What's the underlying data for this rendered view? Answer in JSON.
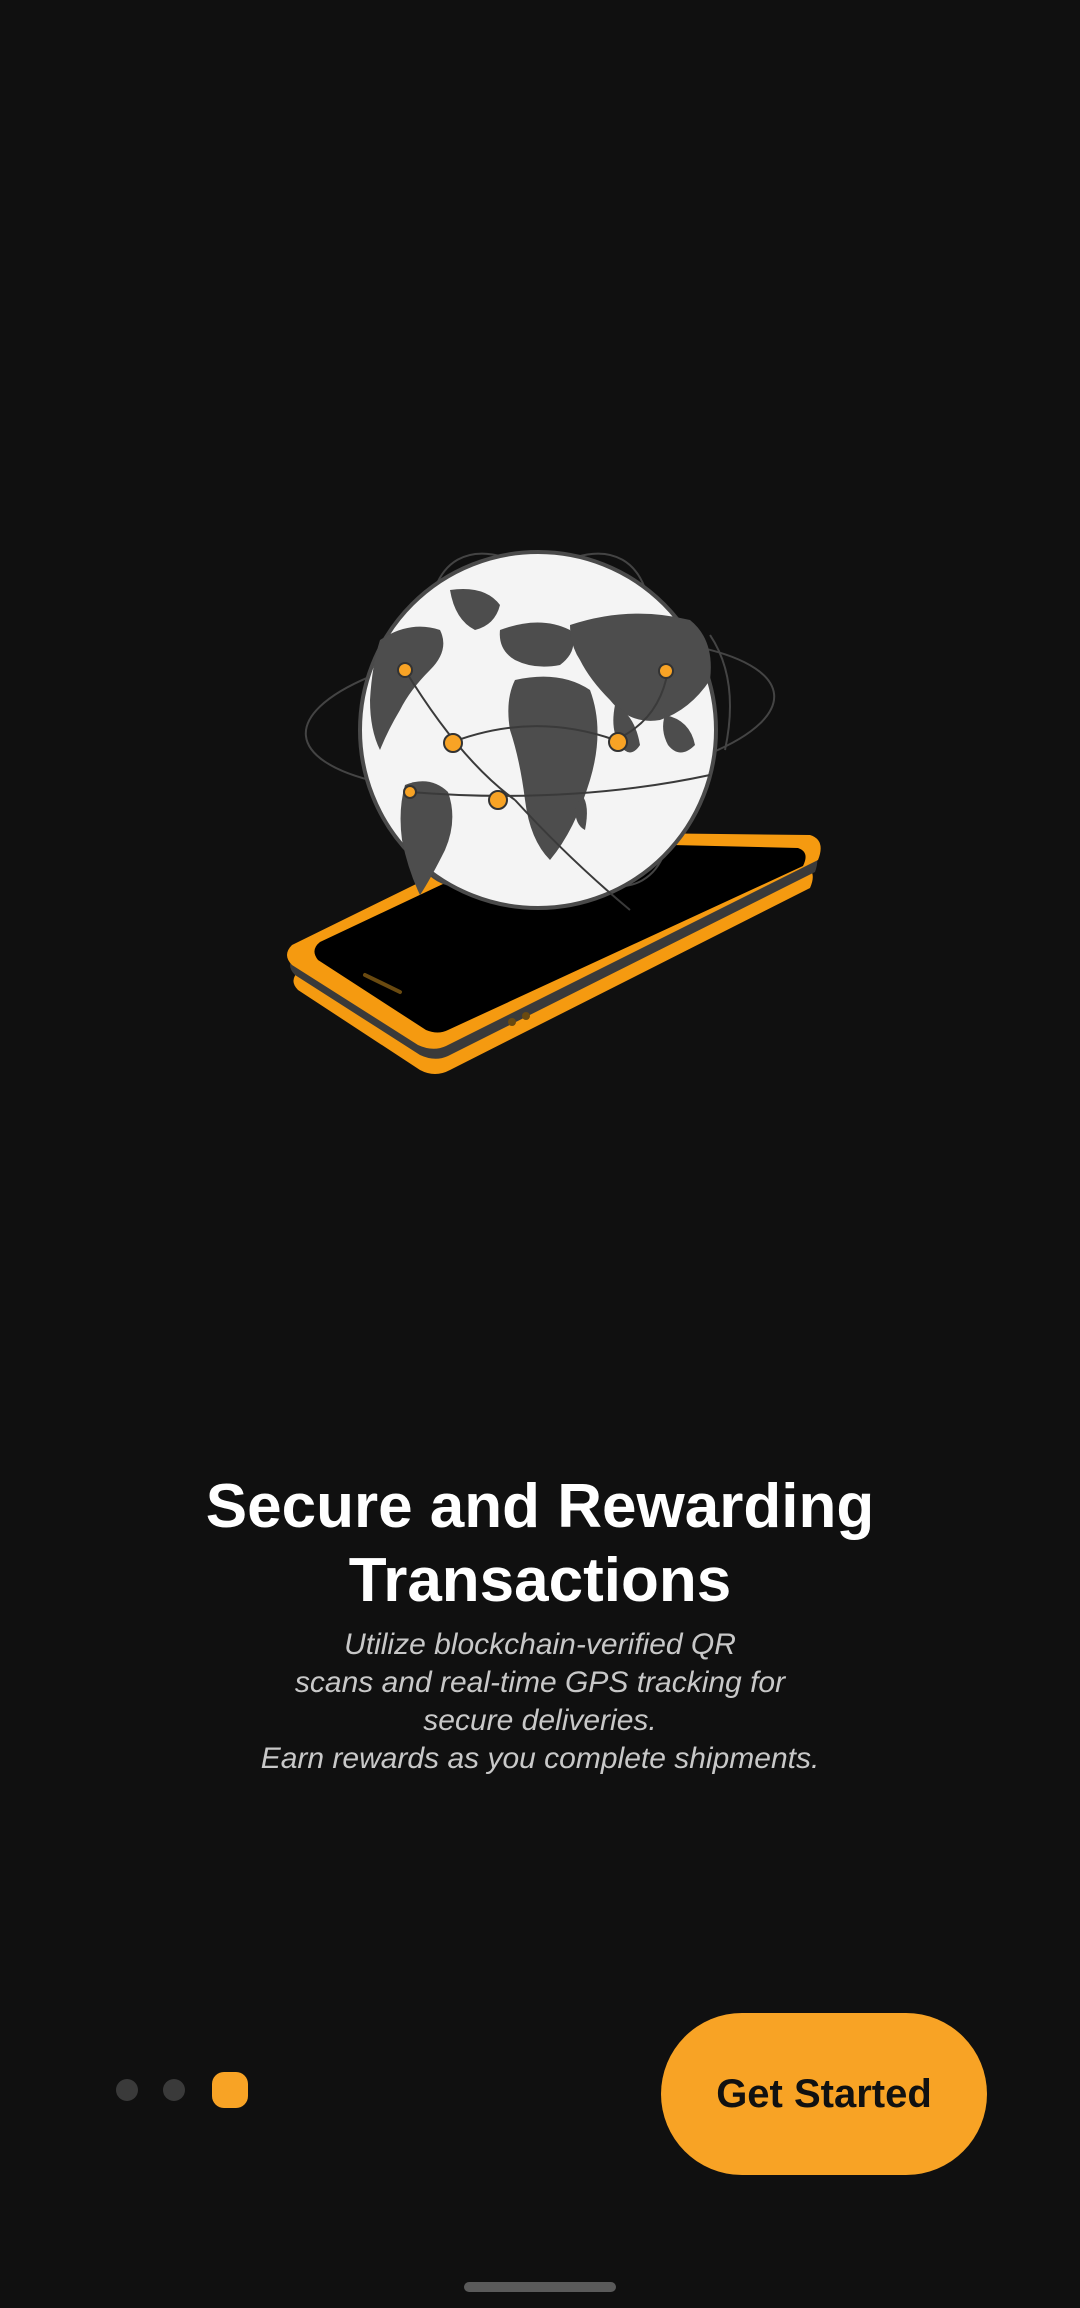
{
  "onboarding": {
    "title": "Secure and Rewarding Transactions",
    "subtitle": "Utilize blockchain-verified QR\nscans and real-time GPS tracking for\nsecure deliveries.\nEarn rewards as you complete shipments.",
    "illustration_icon": "globe-on-smartphone-icon",
    "page_indicator": {
      "total": 3,
      "current": 3
    },
    "cta_label": "Get Started"
  },
  "colors": {
    "background": "#101010",
    "accent": "#f8a325",
    "title": "#ffffff",
    "subtitle": "#c8c8c8",
    "inactive_dot": "#3a3a3a"
  }
}
